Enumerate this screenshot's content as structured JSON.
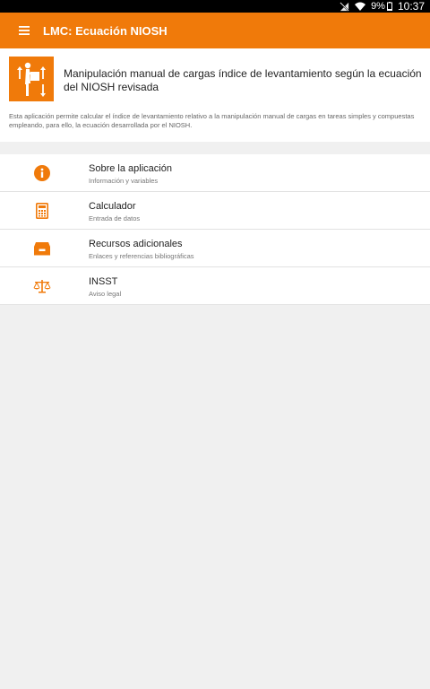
{
  "status_bar": {
    "battery": "9%",
    "time": "10:37",
    "icons": [
      "signal-off-icon",
      "wifi-icon",
      "battery-icon"
    ]
  },
  "app_bar": {
    "title": "LMC: Ecuación NIOSH",
    "menu_icon": "hamburger-menu-icon"
  },
  "header": {
    "logo_icon": "lifting-worker-icon",
    "title": "Manipulación manual de cargas índice de levantamiento según la ecuación del NIOSH revisada",
    "description": "Esta aplicación permite calcular el índice de levantamiento relativo a la manipulación manual de cargas en tareas simples y compuestas empleando, para ello, la ecuación desarrollada por el NIOSH."
  },
  "menu": {
    "items": [
      {
        "icon": "info-icon",
        "title": "Sobre la aplicación",
        "subtitle": "Información y variables"
      },
      {
        "icon": "calculator-icon",
        "title": "Calculador",
        "subtitle": "Entrada de datos"
      },
      {
        "icon": "archive-box-icon",
        "title": "Recursos adicionales",
        "subtitle": "Enlaces y referencias bibliográficas"
      },
      {
        "icon": "scales-icon",
        "title": "INSST",
        "subtitle": "Aviso legal"
      }
    ]
  },
  "colors": {
    "primary": "#f07a0a",
    "background": "#f0f0f0",
    "surface": "#ffffff",
    "text": "#222222",
    "secondary_text": "#777777"
  }
}
